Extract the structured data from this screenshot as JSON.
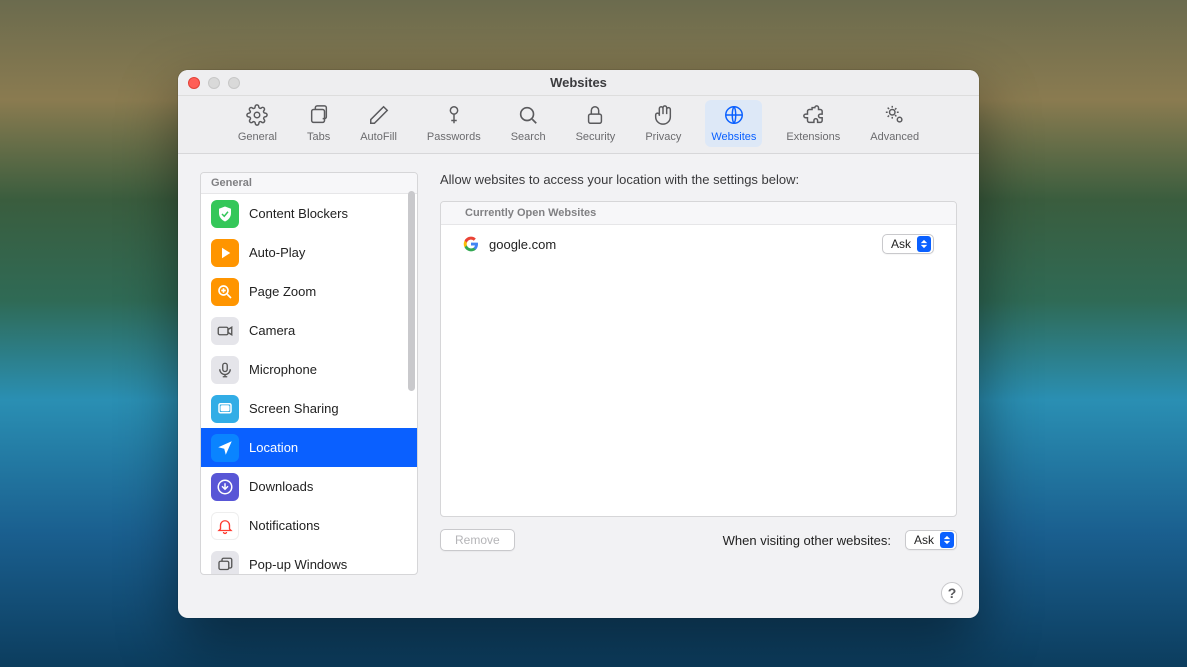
{
  "window": {
    "title": "Websites"
  },
  "toolbar": {
    "items": [
      {
        "label": "General"
      },
      {
        "label": "Tabs"
      },
      {
        "label": "AutoFill"
      },
      {
        "label": "Passwords"
      },
      {
        "label": "Search"
      },
      {
        "label": "Security"
      },
      {
        "label": "Privacy"
      },
      {
        "label": "Websites"
      },
      {
        "label": "Extensions"
      },
      {
        "label": "Advanced"
      }
    ],
    "selected_index": 7
  },
  "sidebar": {
    "heading": "General",
    "items": [
      {
        "label": "Content Blockers"
      },
      {
        "label": "Auto-Play"
      },
      {
        "label": "Page Zoom"
      },
      {
        "label": "Camera"
      },
      {
        "label": "Microphone"
      },
      {
        "label": "Screen Sharing"
      },
      {
        "label": "Location"
      },
      {
        "label": "Downloads"
      },
      {
        "label": "Notifications"
      },
      {
        "label": "Pop-up Windows"
      }
    ],
    "selected_index": 6
  },
  "main": {
    "hint": "Allow websites to access your location with the settings below:",
    "table_heading": "Currently Open Websites",
    "rows": [
      {
        "site": "google.com",
        "value": "Ask"
      }
    ],
    "remove_label": "Remove",
    "other_label": "When visiting other websites:",
    "other_value": "Ask"
  },
  "help": "?"
}
